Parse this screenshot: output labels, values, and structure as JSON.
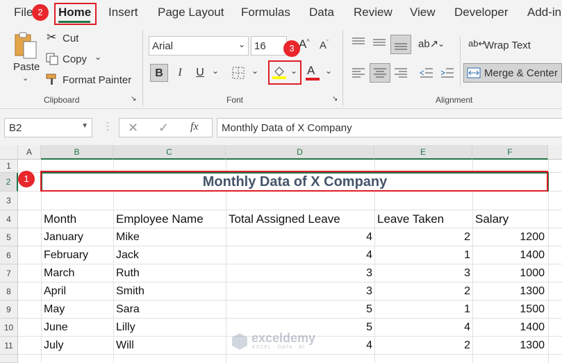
{
  "menu": [
    "File",
    "Home",
    "Insert",
    "Page Layout",
    "Formulas",
    "Data",
    "Review",
    "View",
    "Developer",
    "Add-in"
  ],
  "ribbon": {
    "paste": "Paste",
    "cut": "Cut",
    "copy": "Copy",
    "format_painter": "Format Painter",
    "clipboard_label": "Clipboard",
    "font_name": "Arial",
    "font_size": "16",
    "font_label": "Font",
    "bold": "B",
    "italic": "I",
    "underline": "U",
    "wrap_text": "Wrap Text",
    "merge_center": "Merge & Center",
    "alignment_label": "Alignment",
    "fill_color": "#ffff00",
    "font_color": "#e01c24"
  },
  "badges": [
    "1",
    "2",
    "3"
  ],
  "formula_bar": {
    "name_box": "B2",
    "fx": "fx",
    "content": "Monthly Data of X Company"
  },
  "sheet": {
    "columns": [
      "A",
      "B",
      "C",
      "D",
      "E",
      "F"
    ],
    "rows": [
      "1",
      "2",
      "3",
      "4",
      "5",
      "6",
      "7",
      "8",
      "9",
      "10",
      "11"
    ],
    "title": "Monthly Data of X Company",
    "headers": [
      "Month",
      "Employee Name",
      "Total Assigned Leave",
      "Leave Taken",
      "Salary"
    ],
    "data": [
      [
        "January",
        "Mike",
        "4",
        "2",
        "1200"
      ],
      [
        "February",
        "Jack",
        "4",
        "1",
        "1400"
      ],
      [
        "March",
        "Ruth",
        "3",
        "3",
        "1000"
      ],
      [
        "April",
        "Smith",
        "3",
        "2",
        "1300"
      ],
      [
        "May",
        "Sara",
        "5",
        "1",
        "1500"
      ],
      [
        "June",
        "Lilly",
        "5",
        "4",
        "1400"
      ],
      [
        "July",
        "Will",
        "4",
        "2",
        "1300"
      ]
    ]
  },
  "watermark": {
    "name": "exceldemy",
    "tagline": "EXCEL · DATA · BI"
  }
}
